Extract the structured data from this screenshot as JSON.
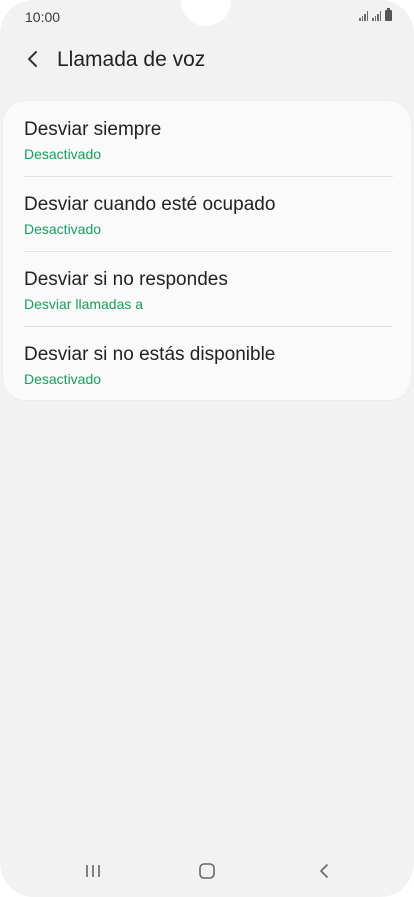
{
  "status_bar": {
    "time": "10:00"
  },
  "header": {
    "title": "Llamada de voz",
    "back_icon": "back-arrow-icon"
  },
  "settings": {
    "items": [
      {
        "title": "Desviar siempre",
        "subtitle": "Desactivado"
      },
      {
        "title": "Desviar cuando esté ocupado",
        "subtitle": "Desactivado"
      },
      {
        "title": "Desviar si no respondes",
        "subtitle": "Desviar llamadas a"
      },
      {
        "title": "Desviar si no estás disponible",
        "subtitle": "Desactivado"
      }
    ]
  },
  "nav_bar": {
    "icons": [
      "recent-apps-icon",
      "home-icon",
      "back-icon"
    ]
  },
  "colors": {
    "accent": "#1a9c5f",
    "background": "#f2f2f2",
    "card": "#fafafa",
    "text": "#222222"
  }
}
